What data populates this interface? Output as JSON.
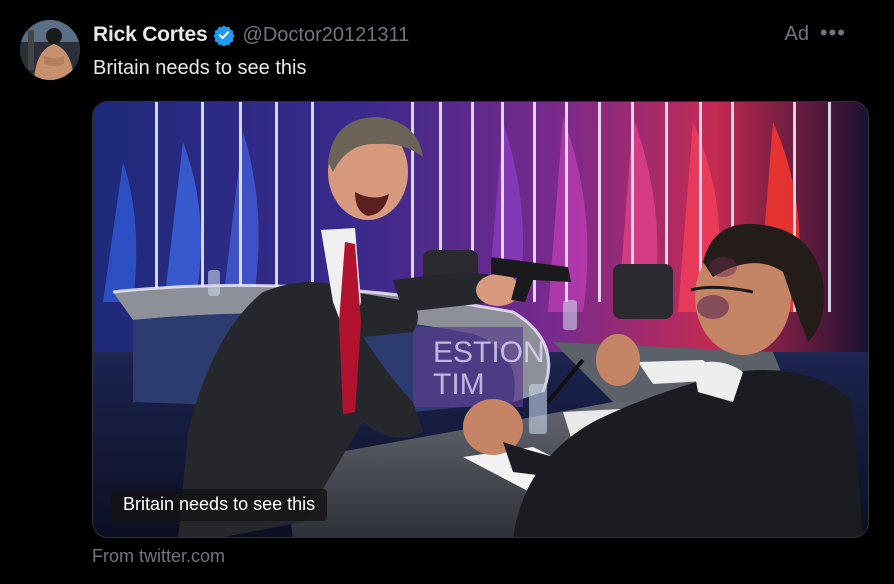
{
  "post": {
    "author": {
      "display_name": "Rick Cortes",
      "handle": "@Doctor20121311",
      "verified": true,
      "avatar_icon": "profile-photo"
    },
    "ad_label": "Ad",
    "more_icon": "more-horizontal-icon",
    "text": "Britain needs to see this",
    "media": {
      "caption": "Britain needs to see this",
      "studio_sign": "QUESTION TIME"
    },
    "source": "From twitter.com"
  },
  "colors": {
    "background": "#000000",
    "text_primary": "#e7e9ea",
    "text_secondary": "#71767b",
    "verified_blue": "#1d9bf0"
  }
}
